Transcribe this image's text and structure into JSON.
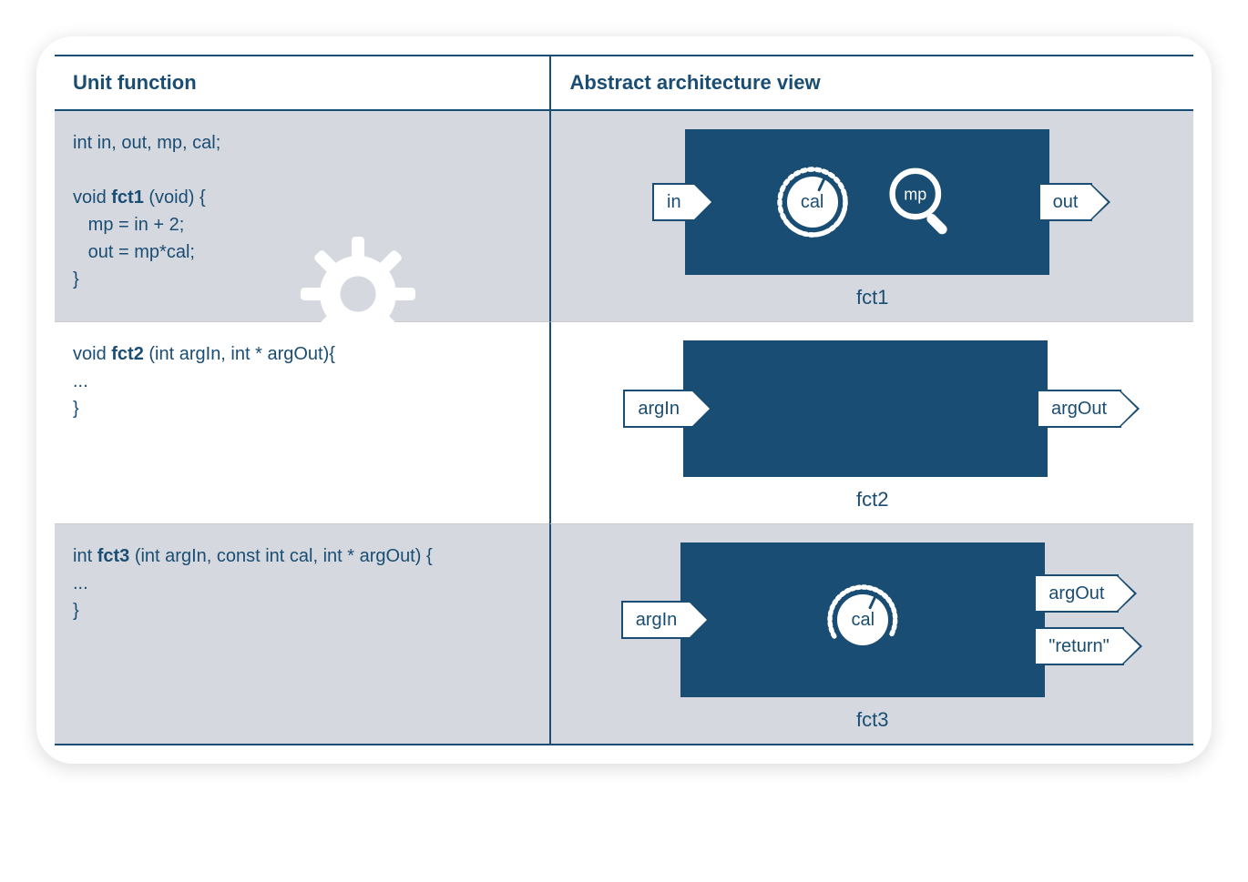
{
  "headers": {
    "left": "Unit function",
    "right": "Abstract architecture view"
  },
  "rows": [
    {
      "code": "int in, out, mp, cal;\n\nvoid fct1 (void) {\n   mp = in + 2;\n   out = mp*cal;\n}",
      "fname": "fct1",
      "block_label": "fct1",
      "inputs": [
        "in"
      ],
      "outputs": [
        "out"
      ],
      "dial_label": "cal",
      "mag_label": "mp",
      "has_dial": true,
      "has_mag": true,
      "has_gear": true,
      "shaded": true,
      "block_w": 400,
      "block_h": 160
    },
    {
      "code": "void fct2 (int argIn, int * argOut){\n...\n}",
      "fname": "fct2",
      "block_label": "fct2",
      "inputs": [
        "argIn"
      ],
      "outputs": [
        "argOut"
      ],
      "has_dial": false,
      "has_mag": false,
      "shaded": false,
      "block_w": 400,
      "block_h": 150
    },
    {
      "code": "int fct3 (int argIn, const int cal, int * argOut) {\n...\n}",
      "fname": "fct3",
      "block_label": "fct3",
      "inputs": [
        "argIn"
      ],
      "outputs": [
        "argOut",
        "\"return\""
      ],
      "dial_label": "cal",
      "has_dial": true,
      "has_mag": false,
      "shaded": true,
      "block_w": 400,
      "block_h": 170
    }
  ]
}
